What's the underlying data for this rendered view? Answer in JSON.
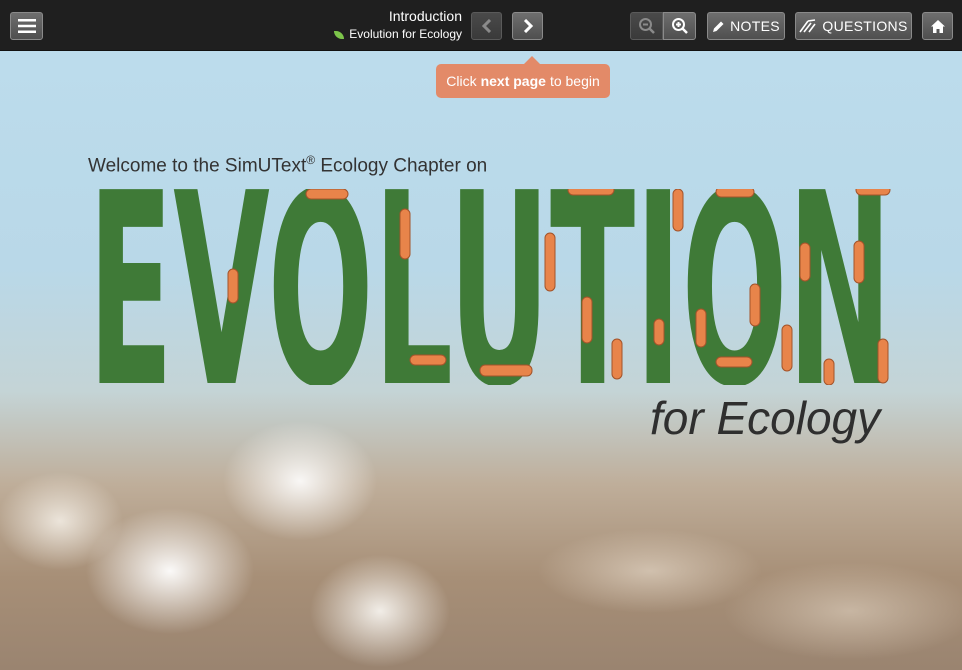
{
  "header": {
    "title": "Introduction",
    "subtitle": "Evolution for Ecology",
    "notes_label": "NOTES",
    "questions_label": "QUESTIONS"
  },
  "tooltip": {
    "pre": "Click",
    "bold": "next page",
    "post": "to begin"
  },
  "hero": {
    "welcome_pre": "Welcome to the SimUText",
    "welcome_reg": "®",
    "welcome_post": " Ecology Chapter on",
    "title_text": "EVOLUTION",
    "subtitle": "for Ecology"
  },
  "colors": {
    "title_green": "#3f7a37",
    "tooltip_bg": "#e38a68",
    "larva": "#e8844a"
  },
  "icons": [
    "menu-icon",
    "leaf-icon",
    "chevron-left-icon",
    "chevron-right-icon",
    "zoom-out-icon",
    "zoom-in-icon",
    "pencil-icon",
    "questions-icon",
    "home-icon"
  ]
}
